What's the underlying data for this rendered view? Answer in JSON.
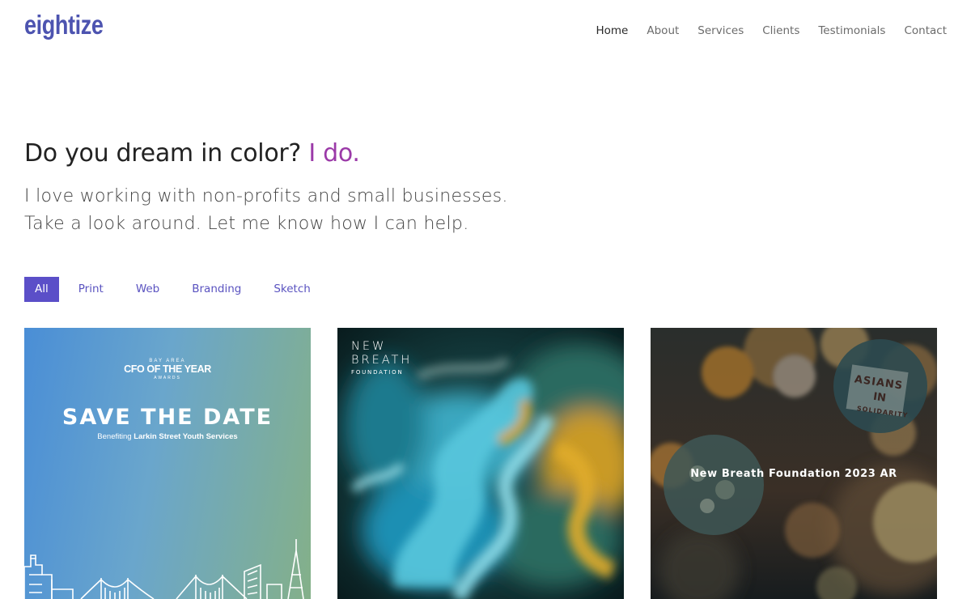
{
  "brand": {
    "logo": "eightize"
  },
  "nav": {
    "items": [
      "Home",
      "About",
      "Services",
      "Clients",
      "Testimonials",
      "Contact"
    ]
  },
  "hero": {
    "headline": "Do you dream in color?",
    "headline_accent": "I do.",
    "sub_line1": "I love working with non-profits and small businesses.",
    "sub_line2": "Take a look around. Let me know how I can help."
  },
  "filters": {
    "items": [
      "All",
      "Print",
      "Web",
      "Branding",
      "Sketch"
    ],
    "active": "All"
  },
  "portfolio": {
    "card1": {
      "kicker": "BAY AREA",
      "award": "CFO OF THE YEAR",
      "award_sub": "AWARDS",
      "title": "SAVE THE DATE",
      "benefit_prefix": "Benefiting",
      "benefit_org": "Larkin Street Youth Services"
    },
    "card2": {
      "logo_line1": "NEW",
      "logo_line2": "BREATH",
      "logo_line3": "FOUNDATION"
    },
    "card3": {
      "caption": "New Breath Foundation 2023 AR",
      "sign_line1": "ASIANS",
      "sign_line2": "IN",
      "sign_line3": "SOLIDARITY"
    }
  },
  "colors": {
    "brand": "#4d54b0",
    "accent": "#9b3aa8",
    "filter_active": "#5b4fc8",
    "filter_text": "#5a53c0"
  }
}
